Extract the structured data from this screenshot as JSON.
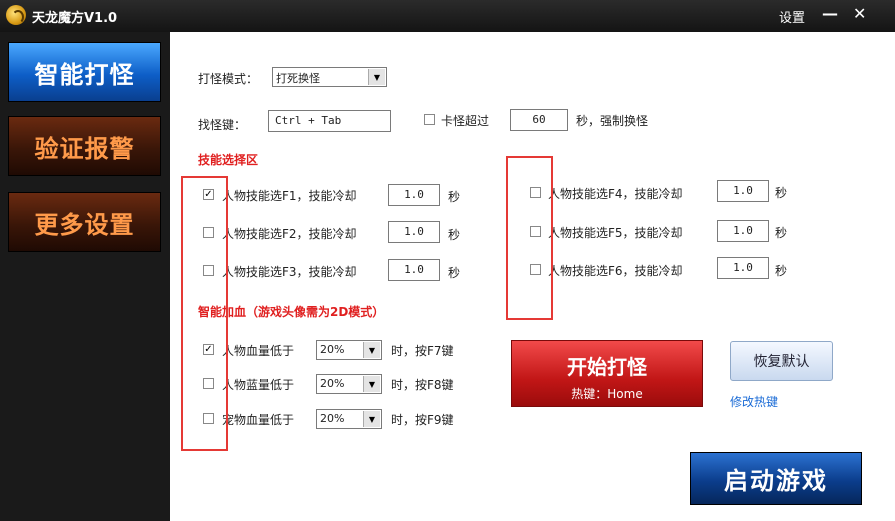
{
  "window": {
    "title": "天龙魔方V1.0",
    "settings": "设置",
    "minimize": "—",
    "close": "✕"
  },
  "sidebar": {
    "items": [
      {
        "label": "智能打怪"
      },
      {
        "label": "验证报警"
      },
      {
        "label": "更多设置"
      }
    ]
  },
  "mode": {
    "label": "打怪模式：",
    "value": "打死换怪"
  },
  "find_key": {
    "label": "找怪键：",
    "value": "Ctrl + Tab"
  },
  "stuck": {
    "label": "卡怪超过",
    "value": "60",
    "suffix": "秒，强制换怪"
  },
  "skills": {
    "title": "技能选择区",
    "left": [
      {
        "label": "人物技能选F1，技能冷却",
        "cooldown": "1.0",
        "unit": "秒",
        "checked": true
      },
      {
        "label": "人物技能选F2，技能冷却",
        "cooldown": "1.0",
        "unit": "秒",
        "checked": false
      },
      {
        "label": "人物技能选F3，技能冷却",
        "cooldown": "1.0",
        "unit": "秒",
        "checked": false
      }
    ],
    "right": [
      {
        "label": "人物技能选F4，技能冷却",
        "cooldown": "1.0",
        "unit": "秒",
        "checked": false
      },
      {
        "label": "人物技能选F5，技能冷却",
        "cooldown": "1.0",
        "unit": "秒",
        "checked": false
      },
      {
        "label": "人物技能选F6，技能冷却",
        "cooldown": "1.0",
        "unit": "秒",
        "checked": false
      }
    ]
  },
  "heal": {
    "title": "智能加血（游戏头像需为2D模式）",
    "rows": [
      {
        "label": "人物血量低于",
        "value": "20%",
        "suffix": "时，按F7键",
        "checked": true
      },
      {
        "label": "人物蓝量低于",
        "value": "20%",
        "suffix": "时，按F8键",
        "checked": false
      },
      {
        "label": "宠物血量低于",
        "value": "20%",
        "suffix": "时，按F9键",
        "checked": false
      }
    ]
  },
  "start_button": {
    "label": "开始打怪",
    "hotkey": "热键：Home"
  },
  "restore_button": {
    "label": "恢复默认"
  },
  "edit_hotkey": {
    "label": "修改热键"
  },
  "launch_button": {
    "label": "启动游戏"
  },
  "colors": {
    "accent_red": "#e02020",
    "nav_active": "#1a6ee0",
    "nav_inactive_text": "#ff9a4a",
    "link": "#1a6bd6"
  }
}
